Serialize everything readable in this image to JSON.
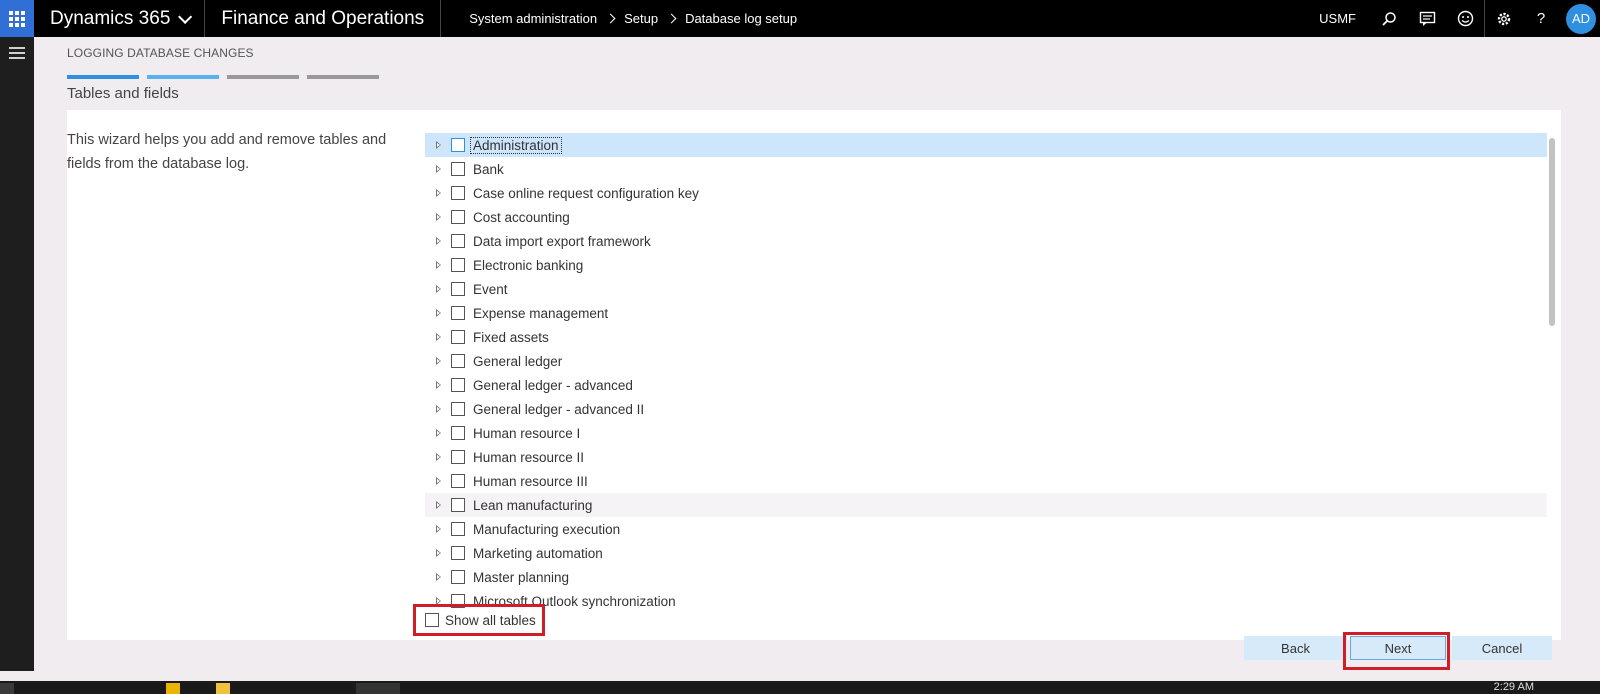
{
  "topbar": {
    "brand": "Dynamics 365",
    "module": "Finance and Operations",
    "breadcrumb": [
      "System administration",
      "Setup",
      "Database log setup"
    ],
    "company": "USMF",
    "avatar_initials": "AD",
    "icons": [
      "search-icon",
      "feedback-icon",
      "smiley-icon",
      "settings-icon",
      "help-icon"
    ]
  },
  "wizard": {
    "caption": "LOGGING DATABASE CHANGES",
    "step_title": "Tables and fields",
    "steps": [
      {
        "state": "active",
        "color": "#2f8fe0"
      },
      {
        "state": "current",
        "color": "#5bb0f0"
      },
      {
        "state": "pending",
        "color": "#999999"
      },
      {
        "state": "pending",
        "color": "#999999"
      }
    ],
    "help_text": "This wizard helps you add and remove tables and fields from the database log."
  },
  "tree": {
    "items": [
      "Administration",
      "Bank",
      "Case online request configuration key",
      "Cost accounting",
      "Data import export framework",
      "Electronic banking",
      "Event",
      "Expense management",
      "Fixed assets",
      "General ledger",
      "General ledger - advanced",
      "General ledger - advanced II",
      "Human resource I",
      "Human resource II",
      "Human resource III",
      "Lean manufacturing",
      "Manufacturing execution",
      "Marketing automation",
      "Master planning",
      "Microsoft Outlook synchronization"
    ],
    "selected_index": 0,
    "hover_index": 15
  },
  "show_all_tables": {
    "label": "Show all tables",
    "checked": false
  },
  "buttons": {
    "back": "Back",
    "next": "Next",
    "cancel": "Cancel"
  },
  "taskbar": {
    "clock": "2:29 AM"
  },
  "colors": {
    "accent": "#2f8fe0",
    "highlight_frame": "#d01e28",
    "button_bg": "#d6eaf9"
  }
}
